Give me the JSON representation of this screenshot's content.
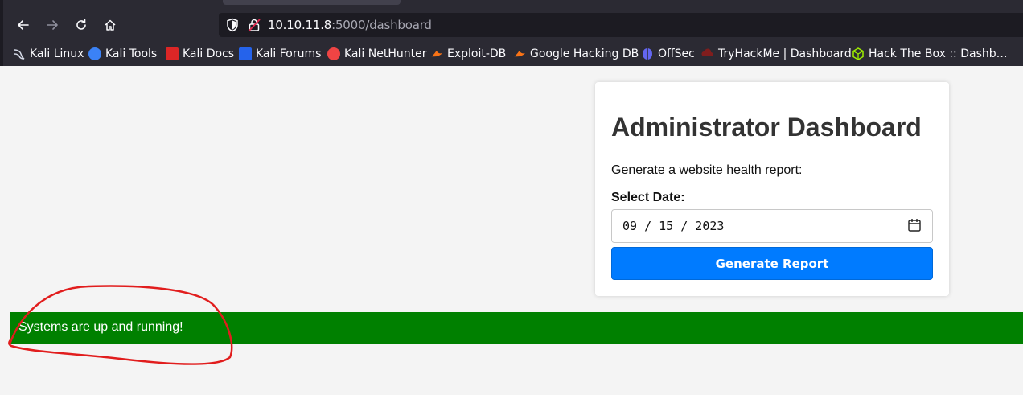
{
  "browser": {
    "url_host": "10.10.11.8",
    "url_path": ":5000/dashboard",
    "nav": [
      "back-icon",
      "forward-icon",
      "reload-icon",
      "home-icon"
    ]
  },
  "bookmarks": [
    {
      "label": "Kali Linux",
      "icon": "kali-dragon-icon",
      "color": "#b9c1d9"
    },
    {
      "label": "Kali Tools",
      "icon": "kali-tools-icon",
      "color": "#3b82f6"
    },
    {
      "label": "Kali Docs",
      "icon": "kali-docs-icon",
      "color": "#dc2626"
    },
    {
      "label": "Kali Forums",
      "icon": "kali-forums-icon",
      "color": "#2563eb"
    },
    {
      "label": "Kali NetHunter",
      "icon": "nethunter-icon",
      "color": "#ef4444"
    },
    {
      "label": "Exploit-DB",
      "icon": "exploit-db-icon",
      "color": "#f97316"
    },
    {
      "label": "Google Hacking DB",
      "icon": "ghdb-icon",
      "color": "#f97316"
    },
    {
      "label": "OffSec",
      "icon": "offsec-icon",
      "color": "#6366f1"
    },
    {
      "label": "TryHackMe | Dashboard",
      "icon": "tryhackme-icon",
      "color": "#b91c1c"
    },
    {
      "label": "Hack The Box :: Dashb…",
      "icon": "hackthebox-icon",
      "color": "#9fef00"
    }
  ],
  "dashboard": {
    "title": "Administrator Dashboard",
    "description": "Generate a website health report:",
    "date_label": "Select Date:",
    "date_value": "09 / 15 / 2023",
    "button_label": "Generate Report"
  },
  "status": {
    "message": "Systems are up and running!",
    "color": "#008000"
  },
  "colors": {
    "accent": "#007bff",
    "annotation": "#e11d1d"
  }
}
